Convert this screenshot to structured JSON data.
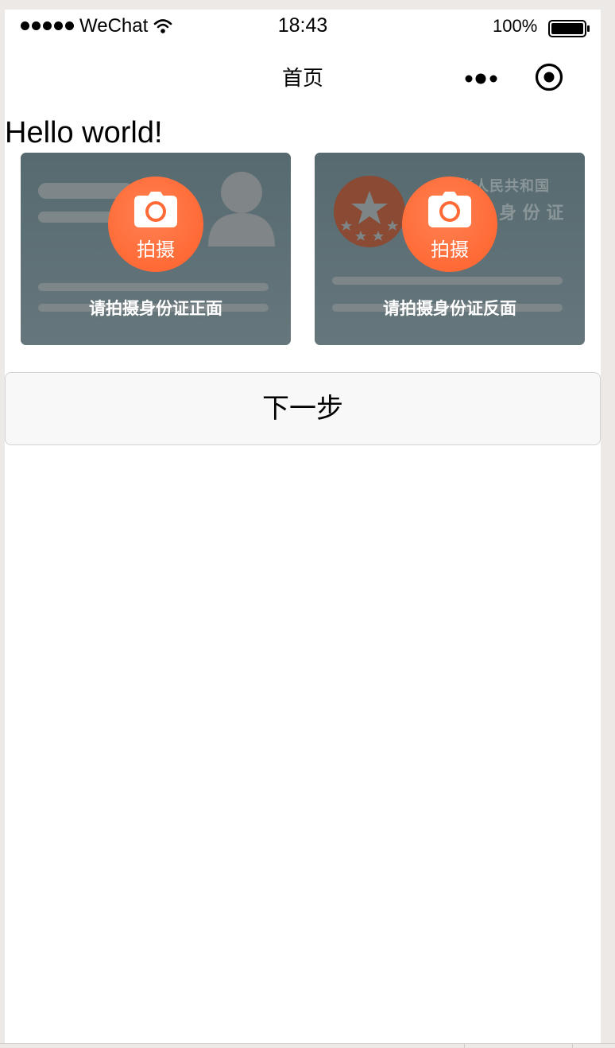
{
  "status_bar": {
    "carrier": "WeChat",
    "time": "18:43",
    "battery": "100%"
  },
  "nav": {
    "title": "首页",
    "more_icon": "more-dots-icon",
    "close_icon": "record-circle-icon"
  },
  "content": {
    "greeting": "Hello world!"
  },
  "id_cards": [
    {
      "button_label": "拍摄",
      "caption": "请拍摄身份证正面",
      "icon": "camera-icon"
    },
    {
      "button_label": "拍摄",
      "caption": "请拍摄身份证反面",
      "icon": "camera-icon",
      "emblem_line1": "华人民共和国",
      "emblem_line2": "身 份 证"
    }
  ],
  "actions": {
    "next_label": "下一步"
  },
  "colors": {
    "accent": "#ff6a36",
    "card_bg": "#5b6e74",
    "button_bg": "#f8f8f8"
  }
}
